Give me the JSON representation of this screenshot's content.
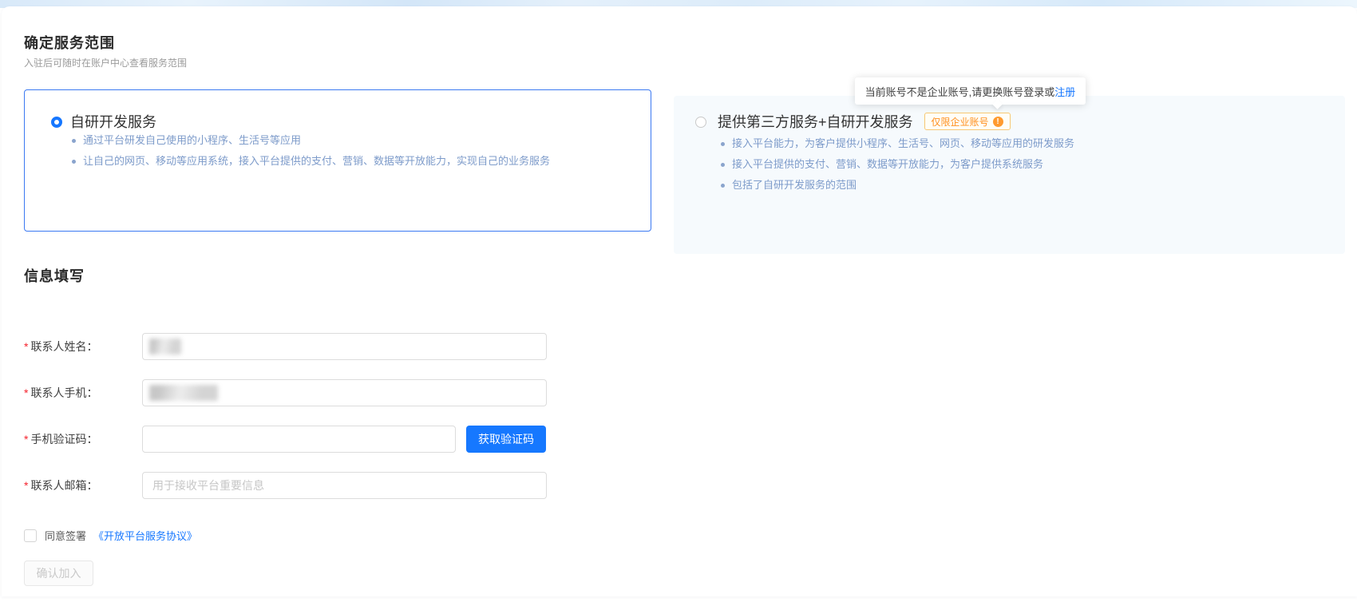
{
  "header": {
    "title": "确定服务范围",
    "subtitle": "入驻后可随时在账户中心查看服务范围"
  },
  "service_options": {
    "self_dev": {
      "title": "自研开发服务",
      "selected": true,
      "bullets": {
        "b1": "通过平台研发自己使用的小程序、生活号等应用",
        "b2": "让自己的网页、移动等应用系统，接入平台提供的支付、营销、数据等开放能力，实现自己的业务服务"
      }
    },
    "third_party": {
      "title": "提供第三方服务+自研开发服务",
      "selected": false,
      "badge": "仅限企业账号",
      "bullets": {
        "b1": "接入平台能力，为客户提供小程序、生活号、网页、移动等应用的研发服务",
        "b2": "接入平台提供的支付、营销、数据等开放能力，为客户提供系统服务",
        "b3": "包括了自研开发服务的范围"
      }
    }
  },
  "tooltip": {
    "text": "当前账号不是企业账号,请更换账号登录或",
    "link_label": "注册"
  },
  "form": {
    "section_title": "信息填写",
    "required_mark": "*",
    "fields": {
      "name": {
        "label": "联系人姓名：",
        "value_hidden": true
      },
      "phone": {
        "label": "联系人手机：",
        "value_hidden": true
      },
      "code": {
        "label": "手机验证码：",
        "button_label": "获取验证码"
      },
      "email": {
        "label": "联系人邮箱：",
        "placeholder": "用于接收平台重要信息"
      }
    },
    "agreement": {
      "prefix": "同意签署",
      "link_label": "《开放平台服务协议》",
      "checked": false
    },
    "submit_label": "确认加入",
    "submit_disabled": true
  },
  "icons": {
    "badge_warning": "!"
  },
  "colors": {
    "accent_blue": "#1677ff",
    "selected_card_border": "#3b79f2",
    "card_muted_text": "#7d9bca",
    "right_card_bg": "#f6fafd",
    "badge_orange": "#ff8f1f",
    "required_red": "#f5222d"
  }
}
